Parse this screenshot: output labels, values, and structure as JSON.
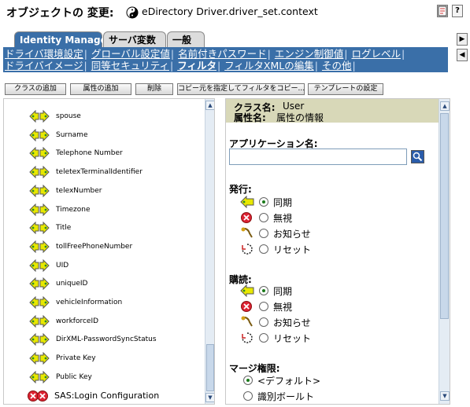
{
  "header": {
    "title": "オブジェクトの 変更:",
    "object": "eDirectory Driver.driver_set.context",
    "icons": [
      "yin-yang-icon",
      "properties-icon",
      "help-icon"
    ],
    "help_label": "?"
  },
  "tabs": [
    {
      "label": "Identity Manager",
      "active": true
    },
    {
      "label": "サーバ変数",
      "active": false
    },
    {
      "label": "一般",
      "active": false
    }
  ],
  "subnav": {
    "row1": [
      "ドライバ環境設定",
      "グローバル設定値",
      "名前付きパスワード",
      "エンジン制御値",
      "ログレベル"
    ],
    "row2": [
      "ドライバイメージ",
      "同等セキュリティ",
      "フィルタ",
      "フィルタXMLの編集",
      "その他"
    ],
    "active": "フィルタ",
    "separator": "|"
  },
  "toolbar": [
    "クラスの追加",
    "属性の追加",
    "削除",
    "コピー元を指定してフィルタをコピー...",
    "テンプレートの設定"
  ],
  "left_list": [
    {
      "label": "spouse"
    },
    {
      "label": "Surname"
    },
    {
      "label": "Telephone Number"
    },
    {
      "label": "teletexTerminalIdentifier"
    },
    {
      "label": "telexNumber"
    },
    {
      "label": "Timezone"
    },
    {
      "label": "Title"
    },
    {
      "label": "tollFreePhoneNumber"
    },
    {
      "label": "UID"
    },
    {
      "label": "uniqueID"
    },
    {
      "label": "vehicleInformation"
    },
    {
      "label": "workforceID"
    },
    {
      "label": "DirXML-PasswordSyncStatus"
    },
    {
      "label": "Private Key"
    },
    {
      "label": "Public Key"
    },
    {
      "label": "SAS:Login Configuration"
    }
  ],
  "right": {
    "class_label": "クラス名:",
    "class_value": "User",
    "attr_label": "属性名:",
    "attr_value": "属性の情報",
    "app_name_label": "アプリケーション名:",
    "app_name_value": "",
    "publish_label": "発行:",
    "subscribe_label": "購読:",
    "options": [
      "同期",
      "無視",
      "お知らせ",
      "リセット"
    ],
    "publish_selected": "同期",
    "subscribe_selected": "同期",
    "merge_label": "マージ権限:",
    "merge_options": [
      "<デフォルト>",
      "識別ボールト"
    ],
    "merge_selected": "<デフォルト>"
  },
  "colors": {
    "tab_active": "#3a6fa8",
    "subnav": "#3a6fa8",
    "panel_header": "#d8d8b8"
  }
}
